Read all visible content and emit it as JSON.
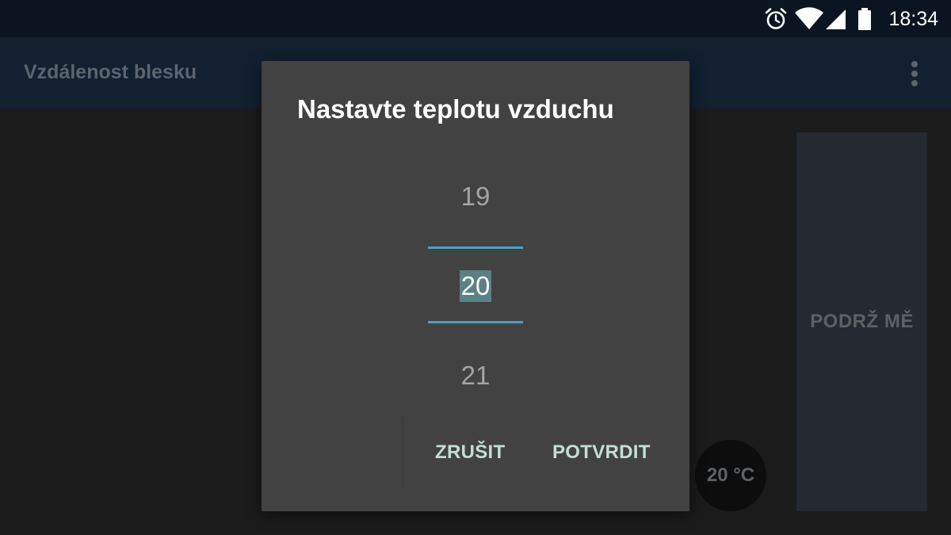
{
  "status_bar": {
    "time": "18:34",
    "icons": [
      "alarm-icon",
      "wifi-icon",
      "signal-icon",
      "battery-icon"
    ]
  },
  "app_bar": {
    "title": "Vzdálenost blesku",
    "menu_icon": "overflow-menu-icon"
  },
  "main": {
    "hold_button_label": "PODRŽ MĚ",
    "temperature_badge": "20 °C"
  },
  "dialog": {
    "title": "Nastavte teplotu vzduchu",
    "picker": {
      "previous": "19",
      "current": "20",
      "next": "21"
    },
    "cancel_label": "ZRUŠIT",
    "confirm_label": "POTVRDIT"
  },
  "colors": {
    "status_bar": "#0b1521",
    "app_bar": "#12202f",
    "background": "#1b1b1b",
    "dialog": "#424242",
    "accent": "#4b9fc9",
    "button_text": "#c5ddd7",
    "selection": "#5c8184"
  }
}
